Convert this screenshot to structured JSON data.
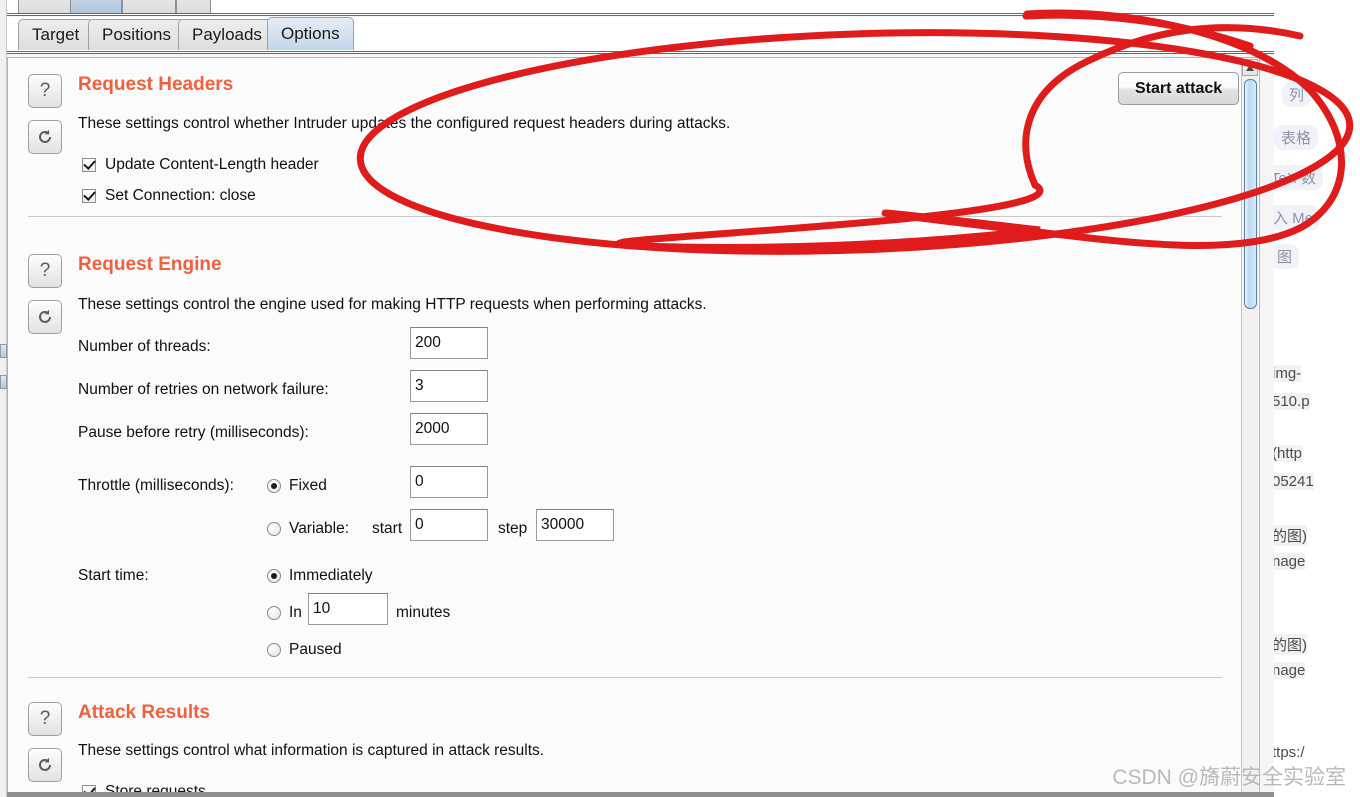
{
  "window": {
    "top_tabs_partial": [
      "",
      "",
      "",
      ""
    ],
    "tabs": [
      {
        "label": "Target",
        "active": false
      },
      {
        "label": "Positions",
        "active": false
      },
      {
        "label": "Payloads",
        "active": false
      },
      {
        "label": "Options",
        "active": true
      }
    ]
  },
  "toolbar": {
    "start_attack_label": "Start attack"
  },
  "sections": [
    {
      "id": "request-headers",
      "title": "Request Headers",
      "description": "These settings control whether Intruder updates the configured request headers during attacks.",
      "help_icon": "question-mark-icon",
      "reset_icon": "refresh-icon",
      "checkboxes": [
        {
          "label": "Update Content-Length header",
          "checked": true
        },
        {
          "label": "Set Connection: close",
          "checked": true
        }
      ]
    },
    {
      "id": "request-engine",
      "title": "Request Engine",
      "description": "These settings control the engine used for making HTTP requests when performing attacks.",
      "help_icon": "question-mark-icon",
      "reset_icon": "refresh-icon",
      "fields": [
        {
          "label": "Number of threads:",
          "value": "200"
        },
        {
          "label": "Number of retries on network failure:",
          "value": "3"
        },
        {
          "label": "Pause before retry (milliseconds):",
          "value": "2000"
        }
      ],
      "throttle": {
        "label": "Throttle (milliseconds):",
        "fixed_label": "Fixed",
        "fixed_selected": true,
        "fixed_value": "0",
        "variable_label": "Variable:",
        "variable_selected": false,
        "start_label": "start",
        "start_value": "0",
        "step_label": "step",
        "step_value": "30000"
      },
      "start_time": {
        "label": "Start time:",
        "options": [
          {
            "label": "Immediately",
            "selected": true
          },
          {
            "label": "In",
            "selected": false,
            "value": "10",
            "suffix": "minutes"
          },
          {
            "label": "Paused",
            "selected": false
          }
        ]
      }
    },
    {
      "id": "attack-results",
      "title": "Attack Results",
      "description": "These settings control what information is captured in attack results.",
      "help_icon": "question-mark-icon",
      "reset_icon": "refresh-icon",
      "checkboxes": [
        {
          "label": "Store requests",
          "checked": true
        }
      ]
    }
  ],
  "background_document": {
    "chips": [
      "列",
      "表格",
      "TeX 数",
      "入 Me",
      "图"
    ],
    "lines": [
      "img-",
      "510.p",
      "(http",
      "05241",
      "的图)",
      "nage",
      "的图)",
      "nage",
      "ttps:/"
    ]
  },
  "annotation": {
    "type": "hand-drawn-red-ellipse",
    "color": "#e01b1b"
  },
  "watermark": {
    "text": "CSDN @旖蔚安全实验室"
  }
}
